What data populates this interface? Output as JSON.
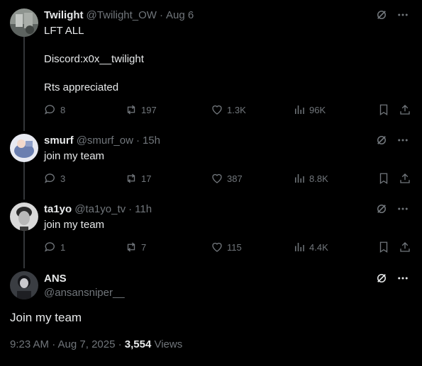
{
  "replies": [
    {
      "name": "Twilight",
      "handle": "@Twilight_OW",
      "separator": "·",
      "time": "Aug 6",
      "lines": [
        "LFT ALL",
        "Discord:x0x__twilight",
        "Rts appreciated"
      ],
      "stats": {
        "replies": "8",
        "reposts": "197",
        "likes": "1.3K",
        "views": "96K"
      }
    },
    {
      "name": "smurf",
      "handle": "@smurf_ow",
      "separator": "·",
      "time": "15h",
      "lines": [
        "join my team"
      ],
      "stats": {
        "replies": "3",
        "reposts": "17",
        "likes": "387",
        "views": "8.8K"
      }
    },
    {
      "name": "ta1yo",
      "handle": "@ta1yo_tv",
      "separator": "·",
      "time": "11h",
      "lines": [
        "join my team"
      ],
      "stats": {
        "replies": "1",
        "reposts": "7",
        "likes": "115",
        "views": "4.4K"
      }
    }
  ],
  "main_post": {
    "name": "ANS",
    "handle": "@ansansniper__",
    "text": "Join my team",
    "timestamp": "9:23 AM · Aug 7, 2025 · ",
    "views_count": "3,554",
    "views_label": " Views"
  },
  "icons": {
    "grok": "grok-icon",
    "more": "more-icon",
    "reply": "reply-icon",
    "repost": "repost-icon",
    "like": "like-icon",
    "views": "views-icon",
    "bookmark": "bookmark-icon",
    "share": "share-icon"
  },
  "colors": {
    "background": "#000000",
    "text": "#e7e9ea",
    "secondary": "#71767b",
    "thread_line": "#333639"
  }
}
